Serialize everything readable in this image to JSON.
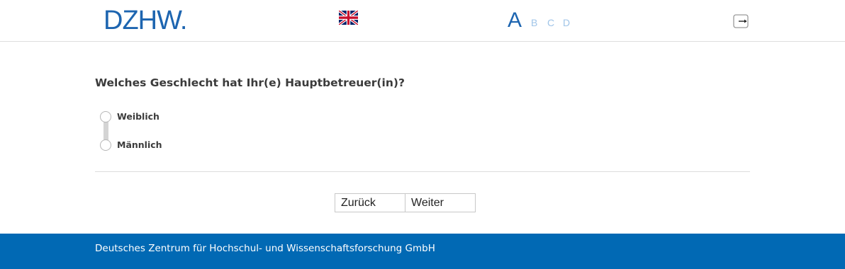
{
  "header": {
    "logo_text": "DZHW.",
    "language_flag_icon": "uk-flag-icon",
    "steps": [
      "A",
      "B",
      "C",
      "D"
    ],
    "active_step": "A",
    "logout_icon": "logout-icon"
  },
  "question": {
    "text": "Welches Geschlecht hat Ihr(e) Hauptbetreuer(in)?",
    "options": [
      "Weiblich",
      "Männlich"
    ]
  },
  "nav": {
    "back_label": "Zurück",
    "next_label": "Weiter"
  },
  "footer": {
    "text": "Deutsches Zentrum für Hochschul- und Wissenschaftsforschung GmbH"
  },
  "colors": {
    "brand": "#1d65b0",
    "footer_bg": "#0169b4",
    "step_inactive": "#9fc4e8"
  }
}
